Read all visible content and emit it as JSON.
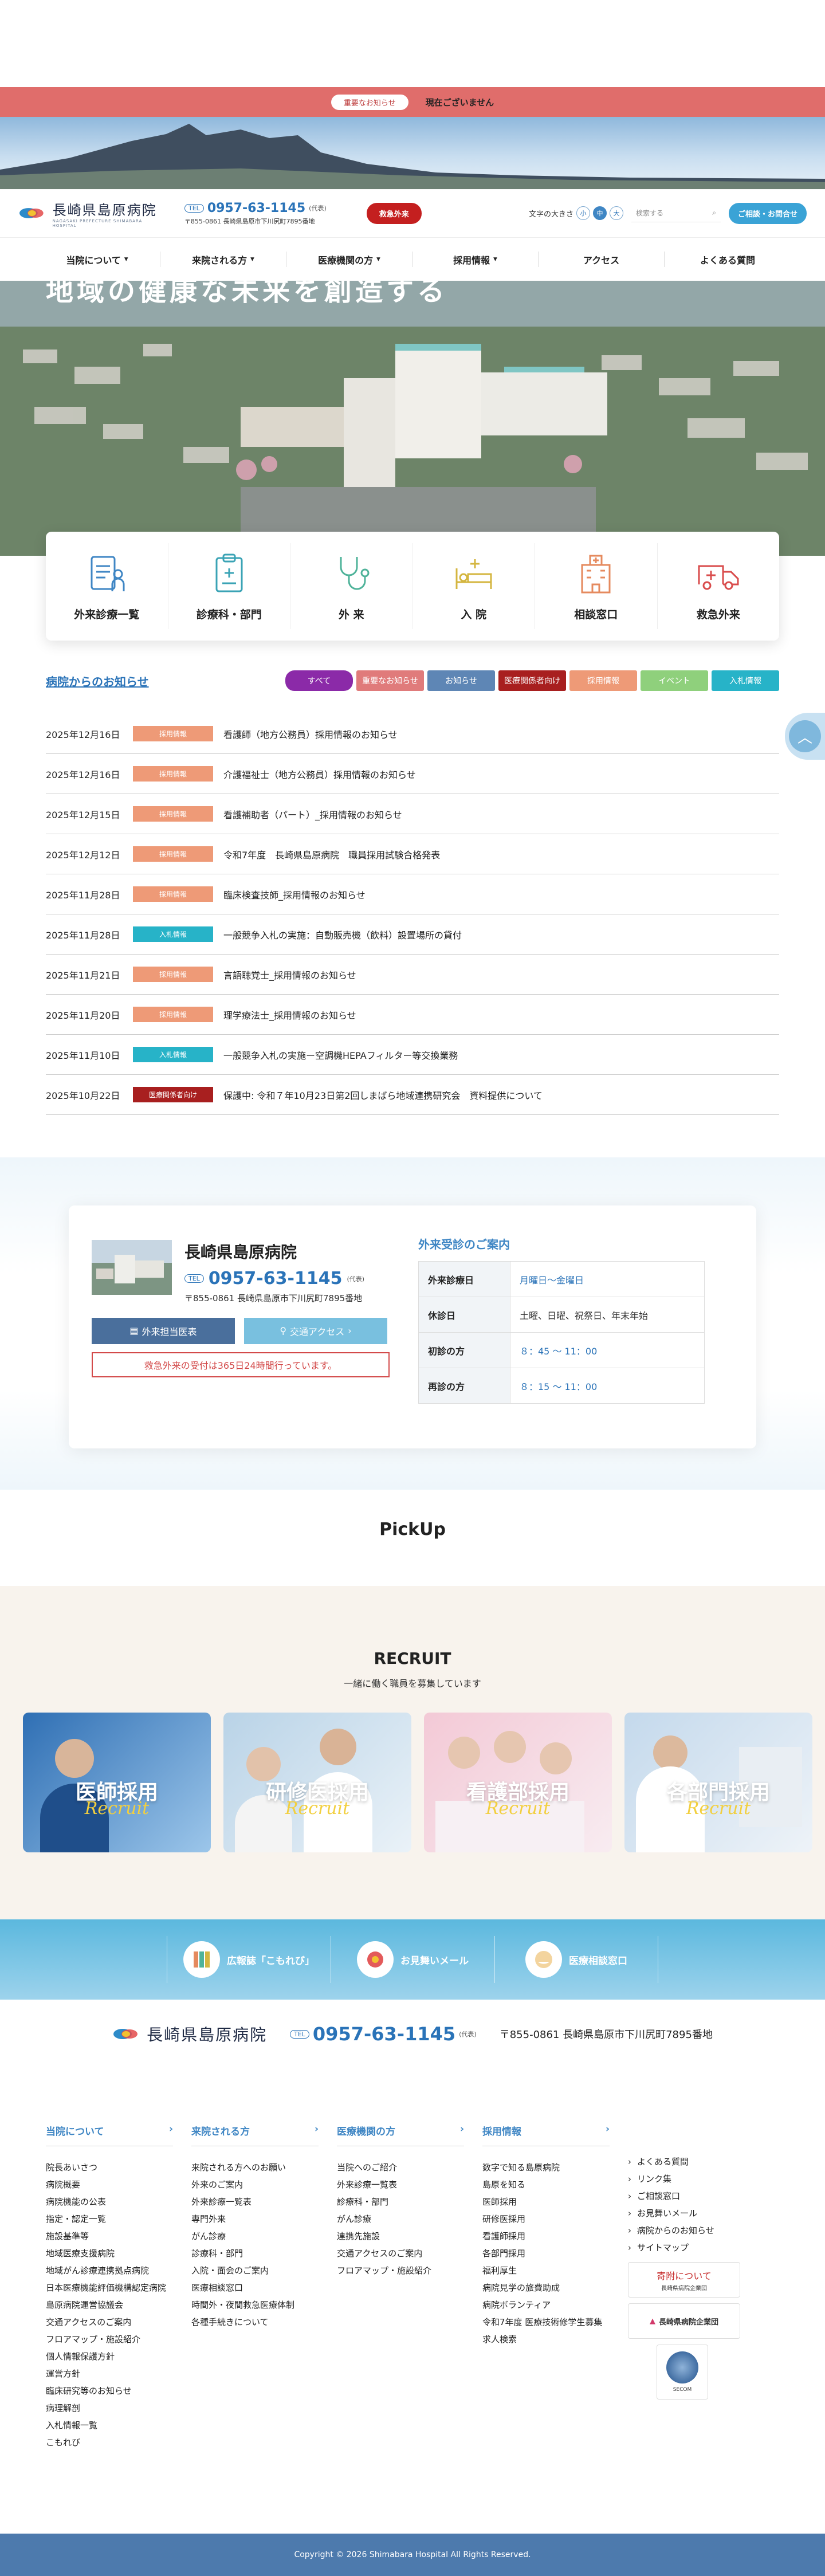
{
  "alert": {
    "badge": "重要なお知らせ",
    "text": "現在ございません"
  },
  "header": {
    "logo_text": "長崎県島原病院",
    "logo_sub": "NAGASAKI PREFECTURE SHIMABARA HOSPITAL",
    "tel_badge": "TEL",
    "tel": "0957-63-1145",
    "tel_note": "(代表)",
    "address": "〒855-0861 長崎県島原市下川尻町7895番地",
    "emergency": "救急外来",
    "fontsize_label": "文字の大きさ",
    "fontsize_small": "小",
    "fontsize_mid": "中",
    "fontsize_large": "大",
    "search_placeholder": "検索する",
    "consult": "ご相談・お問合せ"
  },
  "nav": [
    {
      "label": "当院について",
      "caret": "▾"
    },
    {
      "label": "来院される方",
      "caret": "▾"
    },
    {
      "label": "医療機関の方",
      "caret": "▾"
    },
    {
      "label": "採用情報",
      "caret": "▾"
    },
    {
      "label": "アクセス",
      "caret": ""
    },
    {
      "label": "よくある質問",
      "caret": ""
    }
  ],
  "hero": {
    "title": "地域の健康な未来を創造する"
  },
  "quick": [
    {
      "label": "外来診療一覧",
      "icon": "clipboard-person-icon"
    },
    {
      "label": "診療科・部門",
      "icon": "clipboard-icon"
    },
    {
      "label": "外 来",
      "icon": "stethoscope-icon"
    },
    {
      "label": "入 院",
      "icon": "bed-icon"
    },
    {
      "label": "相談窓口",
      "icon": "building-icon"
    },
    {
      "label": "救急外来",
      "icon": "ambulance-icon"
    }
  ],
  "news": {
    "title": "病院からのお知らせ",
    "filters": [
      {
        "label": "すべて",
        "color": "#8b2aa8"
      },
      {
        "label": "重要なお知らせ",
        "color": "#e07b7b"
      },
      {
        "label": "お知らせ",
        "color": "#5e86b5"
      },
      {
        "label": "医療関係者向け",
        "color": "#a81f1f"
      },
      {
        "label": "採用情報",
        "color": "#ee9a77"
      },
      {
        "label": "イベント",
        "color": "#8fd07c"
      },
      {
        "label": "入札情報",
        "color": "#27b3c8"
      }
    ],
    "items": [
      {
        "date": "2025年12月16日",
        "tag": "採用情報",
        "color": "#ee9a77",
        "title": "看護師（地方公務員）採用情報のお知らせ"
      },
      {
        "date": "2025年12月16日",
        "tag": "採用情報",
        "color": "#ee9a77",
        "title": "介護福祉士（地方公務員）採用情報のお知らせ"
      },
      {
        "date": "2025年12月15日",
        "tag": "採用情報",
        "color": "#ee9a77",
        "title": "看護補助者（パート）_採用情報のお知らせ"
      },
      {
        "date": "2025年12月12日",
        "tag": "採用情報",
        "color": "#ee9a77",
        "title": "令和7年度　長崎県島原病院　職員採用試験合格発表"
      },
      {
        "date": "2025年11月28日",
        "tag": "採用情報",
        "color": "#ee9a77",
        "title": "臨床検査技師_採用情報のお知らせ"
      },
      {
        "date": "2025年11月28日",
        "tag": "入札情報",
        "color": "#27b3c8",
        "title": "一般競争入札の実施：自動販売機（飲料）設置場所の貸付"
      },
      {
        "date": "2025年11月21日",
        "tag": "採用情報",
        "color": "#ee9a77",
        "title": "言語聴覚士_採用情報のお知らせ"
      },
      {
        "date": "2025年11月20日",
        "tag": "採用情報",
        "color": "#ee9a77",
        "title": "理学療法士_採用情報のお知らせ"
      },
      {
        "date": "2025年11月10日",
        "tag": "入札情報",
        "color": "#27b3c8",
        "title": "一般競争入札の実施ー空調機HEPAフィルター等交換業務"
      },
      {
        "date": "2025年10月22日",
        "tag": "医療関係者向け",
        "color": "#a81f1f",
        "title": "保護中: 令和７年10月23日第2回しまばら地域連携研究会　資料提供について"
      }
    ]
  },
  "info": {
    "name": "長崎県島原病院",
    "tel_badge": "TEL",
    "tel": "0957-63-1145",
    "tel_note": "(代表)",
    "address": "〒855-0861 長崎県島原市下川尻町7895番地",
    "btn_schedule": "外来担当医表",
    "btn_access": "交通アクセス",
    "emergency_note": "救急外来の受付は365日24時間行っています。",
    "outpatient_title": "外来受診のご案内",
    "table": [
      {
        "h": "外来診療日",
        "v": "月曜日～金曜日",
        "blue": true
      },
      {
        "h": "休診日",
        "v": "土曜、日曜、祝祭日、年末年始",
        "blue": false
      },
      {
        "h": "初診の方",
        "v": "８：45 ～ 11：00",
        "blue": true
      },
      {
        "h": "再診の方",
        "v": "８：15 ～ 11：00",
        "blue": true
      }
    ]
  },
  "pickup": {
    "title": "PickUp"
  },
  "recruit": {
    "title": "RECRUIT",
    "subtitle": "一緒に働く職員を募集しています",
    "script": "Recruit",
    "cards": [
      {
        "label": "医師採用",
        "bg1": "#2f6fb4",
        "bg2": "#9cc6ea"
      },
      {
        "label": "研修医採用",
        "bg1": "#b9d3e7",
        "bg2": "#eaf2f8"
      },
      {
        "label": "看護部採用",
        "bg1": "#f3c9d6",
        "bg2": "#f8ecf1"
      },
      {
        "label": "各部門採用",
        "bg1": "#c4d9ec",
        "bg2": "#eef3f8"
      }
    ]
  },
  "links": [
    {
      "label": "広報誌「こもれび」",
      "icon": "magazine-icon"
    },
    {
      "label": "お見舞いメール",
      "icon": "flower-icon"
    },
    {
      "label": "医療相談窓口",
      "icon": "consult-icon"
    }
  ],
  "footer": {
    "logo_text": "長崎県島原病院",
    "tel_badge": "TEL",
    "tel": "0957-63-1145",
    "tel_note": "(代表)",
    "address": "〒855-0861 長崎県島原市下川尻町7895番地",
    "cols": [
      {
        "title": "当院について",
        "items": [
          "院長あいさつ",
          "病院概要",
          "病院機能の公表",
          "指定・認定一覧",
          "施設基準等",
          "地域医療支援病院",
          "地域がん診療連携拠点病院",
          "日本医療機能評価機構認定病院",
          "島原病院運営協議会",
          "交通アクセスのご案内",
          "フロアマップ・施設紹介",
          "個人情報保護方針",
          "運営方針",
          "臨床研究等のお知らせ",
          "病理解剖",
          "入札情報一覧",
          "こもれび"
        ]
      },
      {
        "title": "来院される方",
        "items": [
          "来院される方へのお願い",
          "外来のご案内",
          "外来診療一覧表",
          "専門外来",
          "がん診療",
          "診療科・部門",
          "入院・面会のご案内",
          "医療相談窓口",
          "時間外・夜間救急医療体制",
          "各種手続きについて"
        ]
      },
      {
        "title": "医療機関の方",
        "items": [
          "当院へのご紹介",
          "外来診療一覧表",
          "診療科・部門",
          "がん診療",
          "連携先施設",
          "交通アクセスのご案内",
          "フロアマップ・施設紹介"
        ]
      },
      {
        "title": "採用情報",
        "items": [
          "数字で知る島原病院",
          "島原を知る",
          "医師採用",
          "研修医採用",
          "看護師採用",
          "各部門採用",
          "福利厚生",
          "病院見学の旅費助成",
          "病院ボランティア",
          "令和7年度 医療技術修学生募集",
          "求人検索"
        ]
      }
    ],
    "side_links": [
      "よくある質問",
      "リンク集",
      "ご相談窓口",
      "お見舞いメール",
      "病院からのお知らせ",
      "サイトマップ"
    ],
    "banner_donation_1": "寄附について",
    "banner_donation_2": "長崎県病院企業団",
    "banner_kigyodan": "長崎県病院企業団",
    "banner_trust": "SECOM"
  },
  "copyright": "Copyright © 2026 Shimabara Hospital All Rights Reserved."
}
